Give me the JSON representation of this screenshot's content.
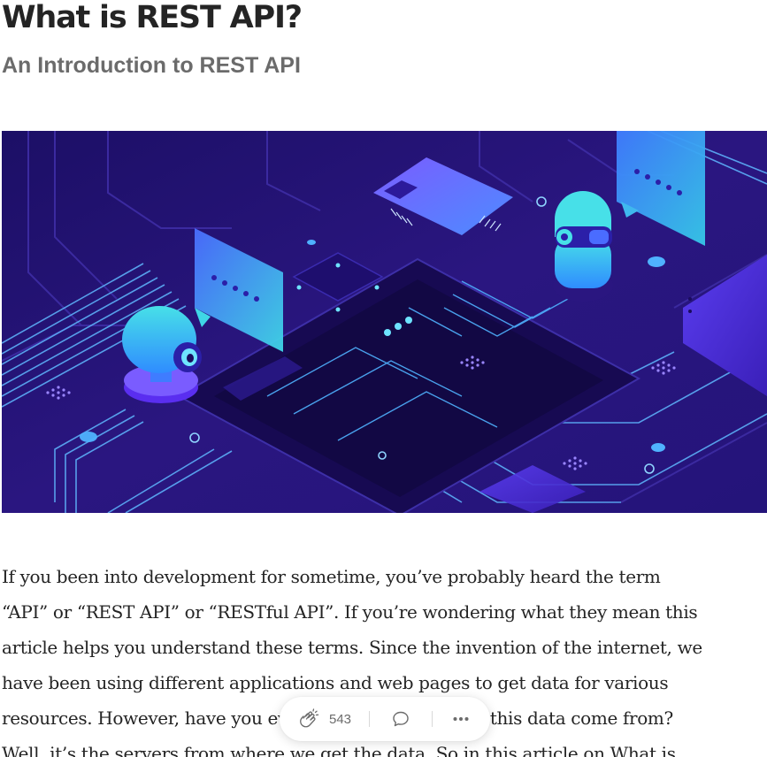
{
  "article": {
    "title": "What is REST API?",
    "subtitle": "An Introduction to REST API",
    "paragraph": "If you been into development for sometime, you’ve probably heard the term\n“API” or “REST API” or “RESTful API”. If you’re wondering what they mean this\narticle helps you understand these terms. Since the invention of the internet, we\nhave been using different applications and web pages to get data for various\nresources. However, have you ever thought where does this data come from?\nWell, it’s the servers from where we get the data. So in this article on What is"
  },
  "hero_image": {
    "alt_icon": "circuit-board-illustration",
    "colors": {
      "background": "#2a1680",
      "board": "#1a0d5e",
      "trace": "#4fb2ff",
      "accent": "#6a4cff",
      "robot": "#3fd6e6"
    }
  },
  "action_bar": {
    "clap_count": "543",
    "clap_icon": "clap-icon",
    "comment_icon": "comment-icon",
    "more_icon": "more-icon"
  }
}
